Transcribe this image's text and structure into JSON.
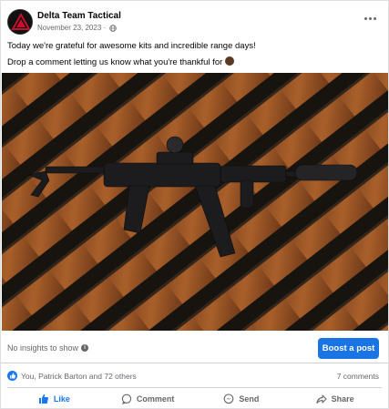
{
  "post": {
    "page_name": "Delta Team Tactical",
    "date": "November 23, 2023 ·",
    "privacy_icon": "globe-icon",
    "caption_line1": "Today we're grateful for awesome kits and incredible range days!",
    "caption_line2": "Drop a comment letting us know what you're thankful for",
    "caption_emoji": "turkey-emoji"
  },
  "photo": {
    "subject": "rifle-on-rusty-grate"
  },
  "insights": {
    "text": "No insights to show",
    "boost_label": "Boost a post"
  },
  "reactions": {
    "summary": "You, Patrick Barton and 72 others",
    "comments": "7 comments"
  },
  "actions": [
    {
      "label": "Like",
      "icon": "thumbs-up-icon"
    },
    {
      "label": "Comment",
      "icon": "comment-bubble-icon"
    },
    {
      "label": "Send",
      "icon": "messenger-icon"
    },
    {
      "label": "Share",
      "icon": "share-arrow-icon"
    }
  ],
  "colors": {
    "accent": "#1b74e4",
    "like_blue": "#1877f2",
    "muted_text": "#65676b",
    "rust": "#a0582a"
  }
}
